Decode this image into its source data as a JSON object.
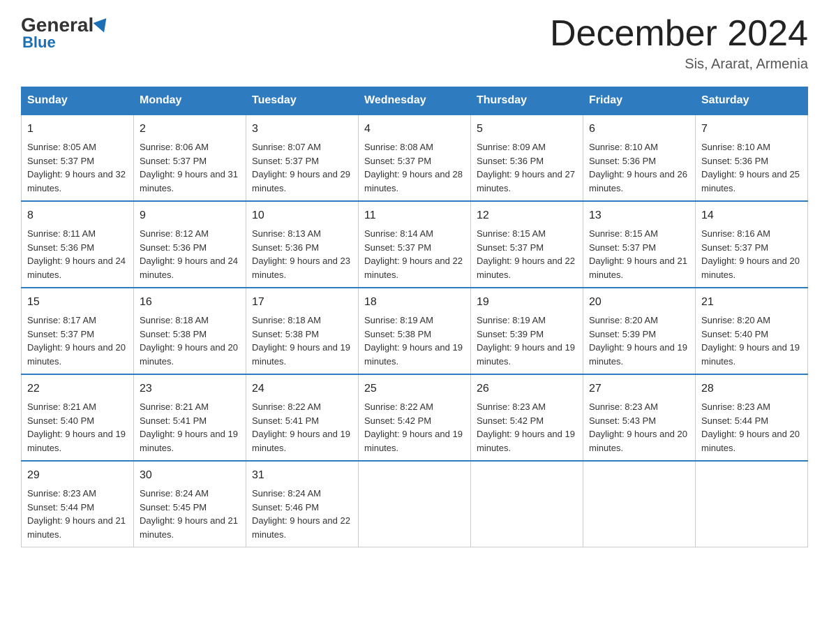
{
  "logo": {
    "general": "General",
    "blue": "Blue"
  },
  "header": {
    "month_title": "December 2024",
    "location": "Sis, Ararat, Armenia"
  },
  "days_of_week": [
    "Sunday",
    "Monday",
    "Tuesday",
    "Wednesday",
    "Thursday",
    "Friday",
    "Saturday"
  ],
  "weeks": [
    [
      {
        "day": "1",
        "sunrise": "8:05 AM",
        "sunset": "5:37 PM",
        "daylight": "9 hours and 32 minutes."
      },
      {
        "day": "2",
        "sunrise": "8:06 AM",
        "sunset": "5:37 PM",
        "daylight": "9 hours and 31 minutes."
      },
      {
        "day": "3",
        "sunrise": "8:07 AM",
        "sunset": "5:37 PM",
        "daylight": "9 hours and 29 minutes."
      },
      {
        "day": "4",
        "sunrise": "8:08 AM",
        "sunset": "5:37 PM",
        "daylight": "9 hours and 28 minutes."
      },
      {
        "day": "5",
        "sunrise": "8:09 AM",
        "sunset": "5:36 PM",
        "daylight": "9 hours and 27 minutes."
      },
      {
        "day": "6",
        "sunrise": "8:10 AM",
        "sunset": "5:36 PM",
        "daylight": "9 hours and 26 minutes."
      },
      {
        "day": "7",
        "sunrise": "8:10 AM",
        "sunset": "5:36 PM",
        "daylight": "9 hours and 25 minutes."
      }
    ],
    [
      {
        "day": "8",
        "sunrise": "8:11 AM",
        "sunset": "5:36 PM",
        "daylight": "9 hours and 24 minutes."
      },
      {
        "day": "9",
        "sunrise": "8:12 AM",
        "sunset": "5:36 PM",
        "daylight": "9 hours and 24 minutes."
      },
      {
        "day": "10",
        "sunrise": "8:13 AM",
        "sunset": "5:36 PM",
        "daylight": "9 hours and 23 minutes."
      },
      {
        "day": "11",
        "sunrise": "8:14 AM",
        "sunset": "5:37 PM",
        "daylight": "9 hours and 22 minutes."
      },
      {
        "day": "12",
        "sunrise": "8:15 AM",
        "sunset": "5:37 PM",
        "daylight": "9 hours and 22 minutes."
      },
      {
        "day": "13",
        "sunrise": "8:15 AM",
        "sunset": "5:37 PM",
        "daylight": "9 hours and 21 minutes."
      },
      {
        "day": "14",
        "sunrise": "8:16 AM",
        "sunset": "5:37 PM",
        "daylight": "9 hours and 20 minutes."
      }
    ],
    [
      {
        "day": "15",
        "sunrise": "8:17 AM",
        "sunset": "5:37 PM",
        "daylight": "9 hours and 20 minutes."
      },
      {
        "day": "16",
        "sunrise": "8:18 AM",
        "sunset": "5:38 PM",
        "daylight": "9 hours and 20 minutes."
      },
      {
        "day": "17",
        "sunrise": "8:18 AM",
        "sunset": "5:38 PM",
        "daylight": "9 hours and 19 minutes."
      },
      {
        "day": "18",
        "sunrise": "8:19 AM",
        "sunset": "5:38 PM",
        "daylight": "9 hours and 19 minutes."
      },
      {
        "day": "19",
        "sunrise": "8:19 AM",
        "sunset": "5:39 PM",
        "daylight": "9 hours and 19 minutes."
      },
      {
        "day": "20",
        "sunrise": "8:20 AM",
        "sunset": "5:39 PM",
        "daylight": "9 hours and 19 minutes."
      },
      {
        "day": "21",
        "sunrise": "8:20 AM",
        "sunset": "5:40 PM",
        "daylight": "9 hours and 19 minutes."
      }
    ],
    [
      {
        "day": "22",
        "sunrise": "8:21 AM",
        "sunset": "5:40 PM",
        "daylight": "9 hours and 19 minutes."
      },
      {
        "day": "23",
        "sunrise": "8:21 AM",
        "sunset": "5:41 PM",
        "daylight": "9 hours and 19 minutes."
      },
      {
        "day": "24",
        "sunrise": "8:22 AM",
        "sunset": "5:41 PM",
        "daylight": "9 hours and 19 minutes."
      },
      {
        "day": "25",
        "sunrise": "8:22 AM",
        "sunset": "5:42 PM",
        "daylight": "9 hours and 19 minutes."
      },
      {
        "day": "26",
        "sunrise": "8:23 AM",
        "sunset": "5:42 PM",
        "daylight": "9 hours and 19 minutes."
      },
      {
        "day": "27",
        "sunrise": "8:23 AM",
        "sunset": "5:43 PM",
        "daylight": "9 hours and 20 minutes."
      },
      {
        "day": "28",
        "sunrise": "8:23 AM",
        "sunset": "5:44 PM",
        "daylight": "9 hours and 20 minutes."
      }
    ],
    [
      {
        "day": "29",
        "sunrise": "8:23 AM",
        "sunset": "5:44 PM",
        "daylight": "9 hours and 21 minutes."
      },
      {
        "day": "30",
        "sunrise": "8:24 AM",
        "sunset": "5:45 PM",
        "daylight": "9 hours and 21 minutes."
      },
      {
        "day": "31",
        "sunrise": "8:24 AM",
        "sunset": "5:46 PM",
        "daylight": "9 hours and 22 minutes."
      },
      null,
      null,
      null,
      null
    ]
  ]
}
